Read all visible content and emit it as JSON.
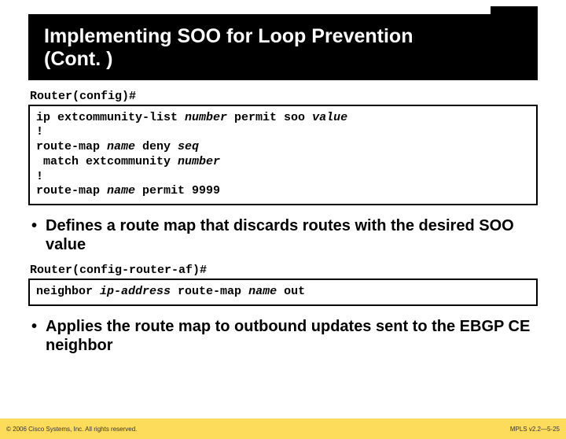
{
  "slide": {
    "title_line1": "Implementing SOO for Loop Prevention",
    "title_line2": "(Cont. )"
  },
  "prompt1": "Router(config)#",
  "code1": {
    "l1_a": "ip extcommunity-list ",
    "l1_b": "number",
    "l1_c": " permit soo ",
    "l1_d": "value",
    "l2": "!",
    "l3_a": "route-map ",
    "l3_b": "name",
    "l3_c": " deny ",
    "l3_d": "seq",
    "l4_a": " match extcommunity ",
    "l4_b": "number",
    "l5": "!",
    "l6_a": "route-map ",
    "l6_b": "name",
    "l6_c": " permit 9999"
  },
  "bullet1": "Defines a route map that discards routes with the desired SOO value",
  "prompt2": "Router(config-router-af)#",
  "code2": {
    "a": "neighbor ",
    "b": "ip-address",
    "c": " route-map ",
    "d": "name",
    "e": " out"
  },
  "bullet2": "Applies the route map to outbound updates sent to the EBGP CE neighbor",
  "footer": {
    "left": "© 2006 Cisco Systems, Inc. All rights reserved.",
    "right": "MPLS v2.2—5-25"
  }
}
